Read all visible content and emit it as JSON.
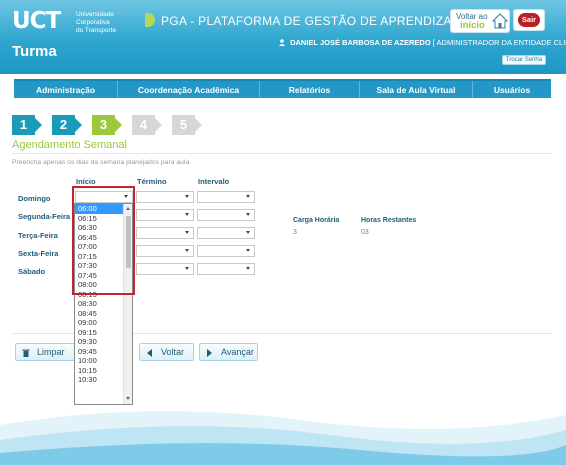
{
  "header": {
    "logo_mark": "UCT",
    "logo_text": [
      "Universidade",
      "Corporativa",
      "do Transporte"
    ],
    "platform_title": "PGA - PLATAFORMA DE GESTÃO DE APRENDIZAGEM",
    "home_button": {
      "line1": "Voltar ao",
      "line2": "início"
    },
    "exit_button": "Sair",
    "page_title": "Turma",
    "user_name": "DANIEL JOSÉ BARBOSA DE AZEREDO",
    "user_role": "[ ADMINISTRADOR DA ENTIDADE CLIENTE ]",
    "change_password": "Trocar Senha"
  },
  "nav": {
    "items": [
      "Administração",
      "Coordenação Acadêmica",
      "Relatórios",
      "Sala de Aula Virtual",
      "Usuários"
    ]
  },
  "steps": {
    "labels": [
      "1",
      "2",
      "3",
      "4",
      "5"
    ],
    "current": 3,
    "colors": {
      "done": "#1a9bb8",
      "current": "#9bc93b",
      "pending": "#d7d7d7"
    }
  },
  "section": {
    "title": "Agendamento Semanal",
    "hint": "Preencha apenas os dias da semana planejados para aula."
  },
  "schedule": {
    "columns": {
      "start": "Início",
      "end": "Término",
      "interval": "Intervalo"
    },
    "days": [
      "Domingo",
      "Segunda-Feira",
      "Terça-Feira",
      "Sexta-Feira",
      "Sábado"
    ]
  },
  "summary": {
    "workload_label": "Carga Horária",
    "workload_value": "3",
    "remaining_label": "Horas Restantes",
    "remaining_value": "03"
  },
  "dropdown": {
    "options": [
      "06:00",
      "06:15",
      "06:30",
      "06:45",
      "07:00",
      "07:15",
      "07:30",
      "07:45",
      "08:00",
      "08:15",
      "08:30",
      "08:45",
      "09:00",
      "09:15",
      "09:30",
      "09:45",
      "10:00",
      "10:15",
      "10:30"
    ],
    "selected": "06:00"
  },
  "buttons": {
    "clear": "Limpar",
    "back": "Voltar",
    "advance": "Avançar"
  },
  "colors": {
    "header": "#2ea6cf",
    "nav": "#2397c6",
    "accent_green": "#9bc93b",
    "highlight": "#c8222a"
  }
}
